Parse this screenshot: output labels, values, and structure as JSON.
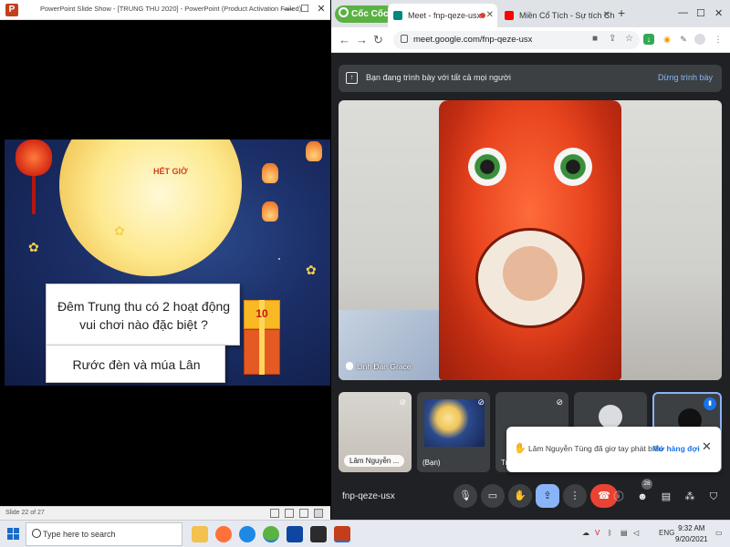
{
  "powerpoint": {
    "window_title": "PowerPoint Slide Show - [TRUNG THU 2020] - PowerPoint (Product Activation Failed)",
    "slide": {
      "moon_text": "HẾT GIỜ",
      "question": "Đêm Trung thu có 2 hoạt động vui chơi nào đặc biệt ?",
      "answer": "Rước đèn và múa Lân",
      "gift_number": "10"
    },
    "status": {
      "slide_counter": "Slide 22 of 27"
    }
  },
  "browser": {
    "brand": "Cốc Cốc",
    "tabs": [
      {
        "label": "Meet - fnp-qeze-usx",
        "active": true,
        "favicon_color": "#00897b"
      },
      {
        "label": "Miền Cổ Tích - Sự tích Chú C",
        "active": false,
        "favicon_color": "#ff0000"
      }
    ],
    "new_tab_label": "+",
    "url": "meet.google.com/fnp-qeze-usx"
  },
  "meet": {
    "presenting_banner": "Bạn đang trình bày với tất cả mọi người",
    "stop_presenting": "Dừng trình bày",
    "main_speaker": "Linh Đan Grace",
    "thumbnails": [
      {
        "label": "Lâm Nguyễn ..."
      },
      {
        "label": "(Bạn)"
      },
      {
        "label": "Tr"
      }
    ],
    "toast": {
      "text": "Lâm Nguyễn Tùng đã giơ tay phát biểu",
      "action": "Mở hàng đợi",
      "close": "✕"
    },
    "meeting_code": "fnp-qeze-usx",
    "participants_count": "28"
  },
  "taskbar": {
    "search_placeholder": "Type here to search",
    "language": "ENG",
    "time": "9:32 AM",
    "date": "9/20/2021"
  }
}
